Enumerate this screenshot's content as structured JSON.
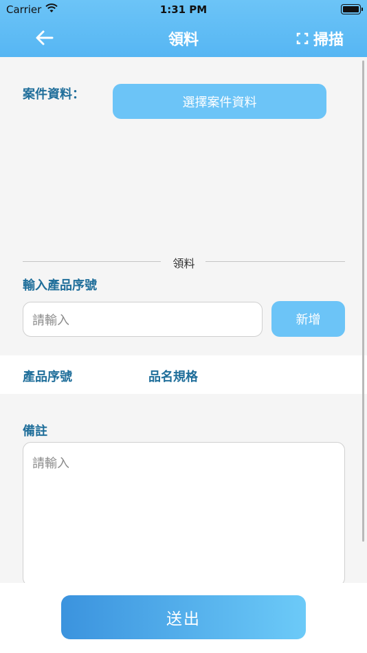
{
  "status_bar": {
    "carrier": "Carrier",
    "time": "1:31 PM"
  },
  "nav": {
    "title": "領料",
    "scan_label": "掃描"
  },
  "case": {
    "label": "案件資料：",
    "choose_button": "選擇案件資料"
  },
  "divider_label": "領料",
  "serial": {
    "label": "輸入產品序號",
    "placeholder": "請輸入",
    "add_button": "新增"
  },
  "table": {
    "columns": [
      "產品序號",
      "品名規格"
    ]
  },
  "remark": {
    "label": "備註",
    "placeholder": "請輸入"
  },
  "submit_button": "送出",
  "colors": {
    "accent": "#6cc4f7",
    "label_text": "#1f6e9a",
    "gradient_start": "#3b93de",
    "gradient_end": "#6ccaf8"
  }
}
